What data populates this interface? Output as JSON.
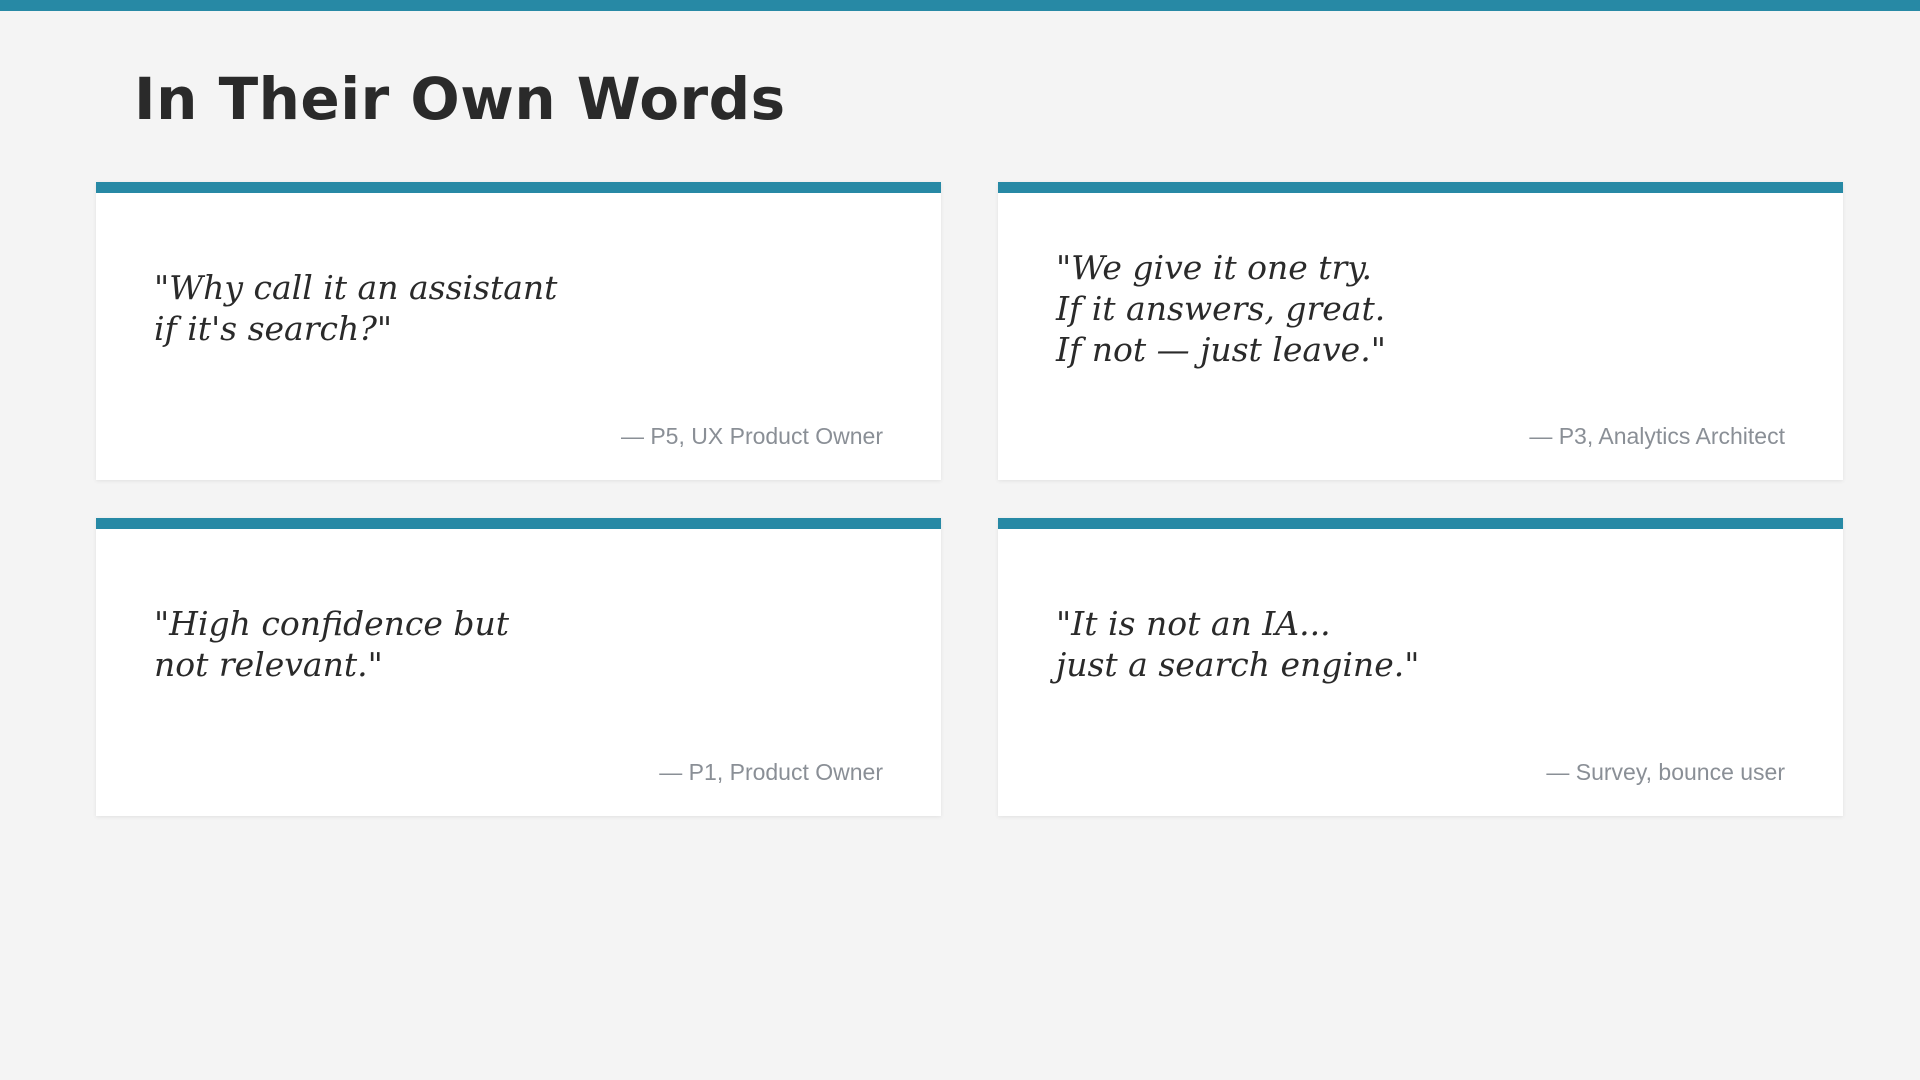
{
  "slide": {
    "title": "In Their Own Words",
    "accent_color": "#2789a5",
    "background_color": "#f4f4f4"
  },
  "quotes": [
    {
      "text": "\"Why call it an assistant\nif it's search?\"",
      "attribution": "— P5, UX Product Owner"
    },
    {
      "text": "\"We give it one try.\nIf it answers, great.\nIf not — just leave.\"",
      "attribution": "— P3, Analytics Architect"
    },
    {
      "text": "\"High confidence but\nnot relevant.\"",
      "attribution": "— P1, Product Owner"
    },
    {
      "text": "\"It is not an IA...\njust a search engine.\"",
      "attribution": "— Survey, bounce user"
    }
  ]
}
